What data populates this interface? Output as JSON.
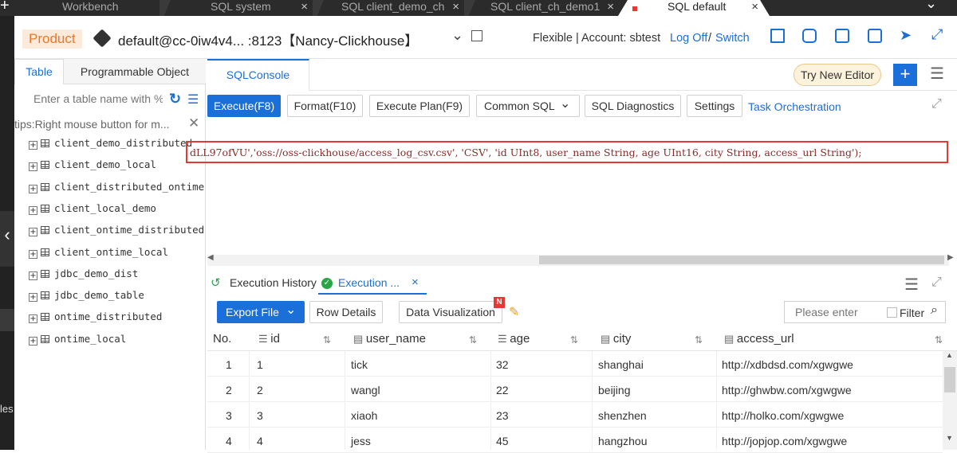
{
  "window_tabs": [
    {
      "label": "Workbench"
    },
    {
      "label": "SQL system",
      "close": "×"
    },
    {
      "label": "SQL client_demo_ch",
      "close": "×"
    },
    {
      "label": "SQL client_ch_demo1",
      "close": "×"
    },
    {
      "label": "SQL default",
      "close": "×",
      "active": true
    }
  ],
  "left_strip_text": "les",
  "header": {
    "product_label": "Product",
    "instance": "default@cc-0iw4v4... :8123【Nancy-Clickhouse】",
    "billing": "Flexible | Account: sbtest",
    "logoff": "Log Off",
    "divider": "/",
    "switch": "Switch"
  },
  "sidebar": {
    "tabs": [
      "Table",
      "Programmable Object"
    ],
    "search_placeholder": "Enter a table name with %",
    "tips": "tips:Right mouse button for m...",
    "tables": [
      "client_demo_distributed",
      "client_demo_local",
      "client_distributed_ontime",
      "client_local_demo",
      "client_ontime_distributed",
      "client_ontime_local",
      "jdbc_demo_dist",
      "jdbc_demo_table",
      "ontime_distributed",
      "ontime_local"
    ]
  },
  "console": {
    "tab": "SQLConsole",
    "try_new_editor": "Try New Editor",
    "toolbar": {
      "execute": "Execute(F8)",
      "format": "Format(F10)",
      "execute_plan": "Execute Plan(F9)",
      "common_sql": "Common SQL",
      "sql_diagnostics": "SQL Diagnostics",
      "settings": "Settings",
      "task_orchestration": "Task Orchestration"
    },
    "sql_text": "dLL97ofVU','oss://oss-clickhouse/access_log_csv.csv', 'CSV', 'id UInt8, user_name String, age UInt16, city String, access_url String');"
  },
  "results": {
    "tabs": {
      "history": "Execution History",
      "execution": "Execution ...",
      "close": "×"
    },
    "toolbar": {
      "export_file": "Export File",
      "row_details": "Row Details",
      "data_visualization": "Data Visualization",
      "new_badge": "N",
      "search_placeholder": "Please enter",
      "filter": "Filter"
    },
    "columns": [
      "No.",
      "id",
      "user_name",
      "age",
      "city",
      "access_url"
    ],
    "rows": [
      [
        "1",
        "1",
        "tick",
        "32",
        "shanghai",
        "http://xdbdsd.com/xgwgwe"
      ],
      [
        "2",
        "2",
        "wangl",
        "22",
        "beijing",
        "http://ghwbw.com/xgwgwe"
      ],
      [
        "3",
        "3",
        "xiaoh",
        "23",
        "shenzhen",
        "http://holko.com/xgwgwe"
      ],
      [
        "4",
        "4",
        "jess",
        "45",
        "hangzhou",
        "http://jopjop.com/xgwgwe"
      ]
    ]
  },
  "colors": {
    "accent": "#1b6fd8",
    "product": "#e8782a",
    "highlight_border": "#e53935",
    "success": "#29a745"
  }
}
